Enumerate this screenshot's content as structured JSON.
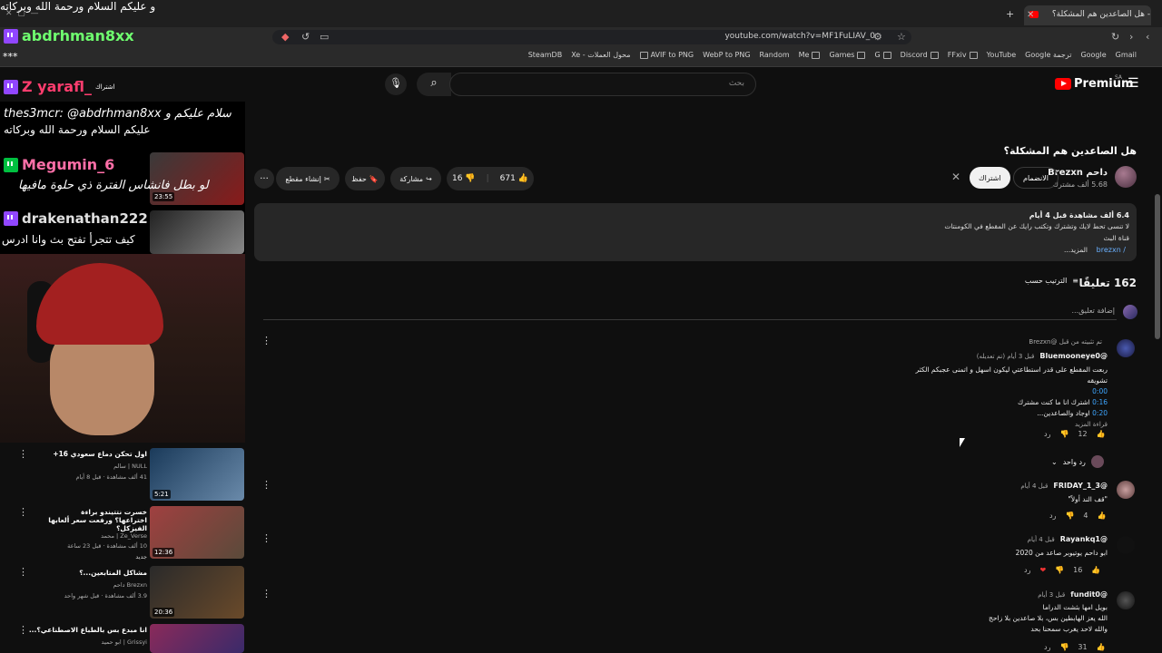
{
  "browser": {
    "tab_title": "هل الصاعدين هم المشكلة؟ - YouTube",
    "address": "youtube.com/watch?v=MF1FuLIAV_0",
    "bookmarks": [
      "SteamDB",
      "Xe - محول العملات",
      "AVIF to PNG",
      "WebP to PNG",
      "Random",
      "Me",
      "Games",
      "G",
      "Discord",
      "FFxiv",
      "YouTube",
      "Google ترجمة",
      "Google",
      "Gmail"
    ]
  },
  "youtube": {
    "logo_label": "Premium",
    "region": "SA",
    "search_placeholder": "بحث"
  },
  "video": {
    "title": "هل الصاعدين هم المشكلة؟",
    "channel_name": "Brezxn داحم",
    "subscribers": "5.68 ألف مشترك",
    "join_label": "الانضمام",
    "subscribe_label": "اشتراك",
    "likes": "671",
    "dislikes": "16",
    "share_label": "مشاركة",
    "save_label": "حفظ",
    "clip_label": "إنشاء مقطع",
    "more_label": "..."
  },
  "description": {
    "meta": "6.4 ألف مشاهدة  قبل 4 أيام",
    "line1": "لا تنسى تحط لايك وتشترك وتكتب رايك عن المقطع في الكومنتات",
    "line2": "قناة البث",
    "link": "brezxn /",
    "more": "...المزيد"
  },
  "comments": {
    "count_label": "162 تعليقًا",
    "sort_label": "الترتيب حسب",
    "add_placeholder": "إضافة تعليق...",
    "items": [
      {
        "pinned": "تم تثبيته من قبل @Brezxn",
        "author": "@Bluemooneye0",
        "time": "قبل 3 أيام (تم تعديله)",
        "lines": [
          "ربعت المقطع على قدر استطاعتي ليكون اسهل و اتمنى عجبكم الكثر",
          "تشويقه"
        ],
        "timestamps": [
          {
            "ts": "0:00",
            "text": ""
          },
          {
            "ts": "0:16",
            "text": "اشترك انا ما كنت مشترك"
          },
          {
            "ts": "0:20",
            "text": "اوجاد والصاعدين..."
          }
        ],
        "read_more": "قراءة المزيد",
        "likes": "12",
        "reply": "رد",
        "replies_label": "رد واحد"
      },
      {
        "author": "@FRIDAY_1_3",
        "time": "قبل 4 أيام",
        "lines": [
          "\"قف الند أولاً\""
        ],
        "likes": "4",
        "reply": "رد"
      },
      {
        "author": "@Rayankq1",
        "time": "قبل 4 أيام",
        "lines": [
          "ابو داحم يوتيوبر صاعد من 2020"
        ],
        "likes": "16",
        "reply": "رد"
      },
      {
        "author": "@fundit0",
        "time": "قبل 3 أيام",
        "lines": [
          "بويل امها بثشت الدراما",
          "الله يعز الهابطين بس، بلا صاعدين بلا زاحج",
          "والله لاحد يغرب سمحنا بحد"
        ],
        "likes": "31",
        "reply": "رد"
      }
    ]
  },
  "stream_overlay": {
    "streamer": "abdrhman8xx",
    "stars": "***",
    "user2": "Z yarafl_",
    "user2_note": "اشتراك",
    "chat1": "thes3mcr: @abdrhman8xx سلام عليكم و",
    "chat2": "عليكم السلام ورحمة الله وبركاته",
    "user3": "Megumin_6",
    "chat3": "لو بطل فانشاس الفترة ذي حلوة مافيها",
    "user4": "drakenathan222",
    "chat4": "كيف تتجرأ تفتح بث وانا ادرس",
    "top_text": "و عليكم السلام ورحمة الله وبركاته",
    "thumb1_duration": "23:55"
  },
  "recommended": [
    {
      "title": "اول تحكن دماع سعودي 16+",
      "channel": "NULL | سالم",
      "meta": "41 ألف مشاهدة · قبل 8 أيام",
      "duration": "5:21"
    },
    {
      "title": "خسرت نتتيندو براءة اختراعها؟ ورفعت سعر ألعابها الفيزكل؟",
      "channel": "Ze_Verse | محمد",
      "meta": "10 ألف مشاهدة · قبل 23 ساعة",
      "badge": "جديد",
      "duration": "12:36"
    },
    {
      "title": "مشاكل المتابعين...؟",
      "channel": "Brezxn داحم",
      "meta": "3.9 ألف مشاهدة · قبل شهر واحد",
      "duration": "20:36"
    },
    {
      "title": "انا مبدع بس بالطباع الاصطناعي؟...",
      "channel": "Grissyi | ابو حميد",
      "meta": "",
      "duration": ""
    }
  ],
  "colors": {
    "accent_red": "#ff0000",
    "link_blue": "#3ea6ff",
    "twitch_purple": "#9146ff"
  }
}
